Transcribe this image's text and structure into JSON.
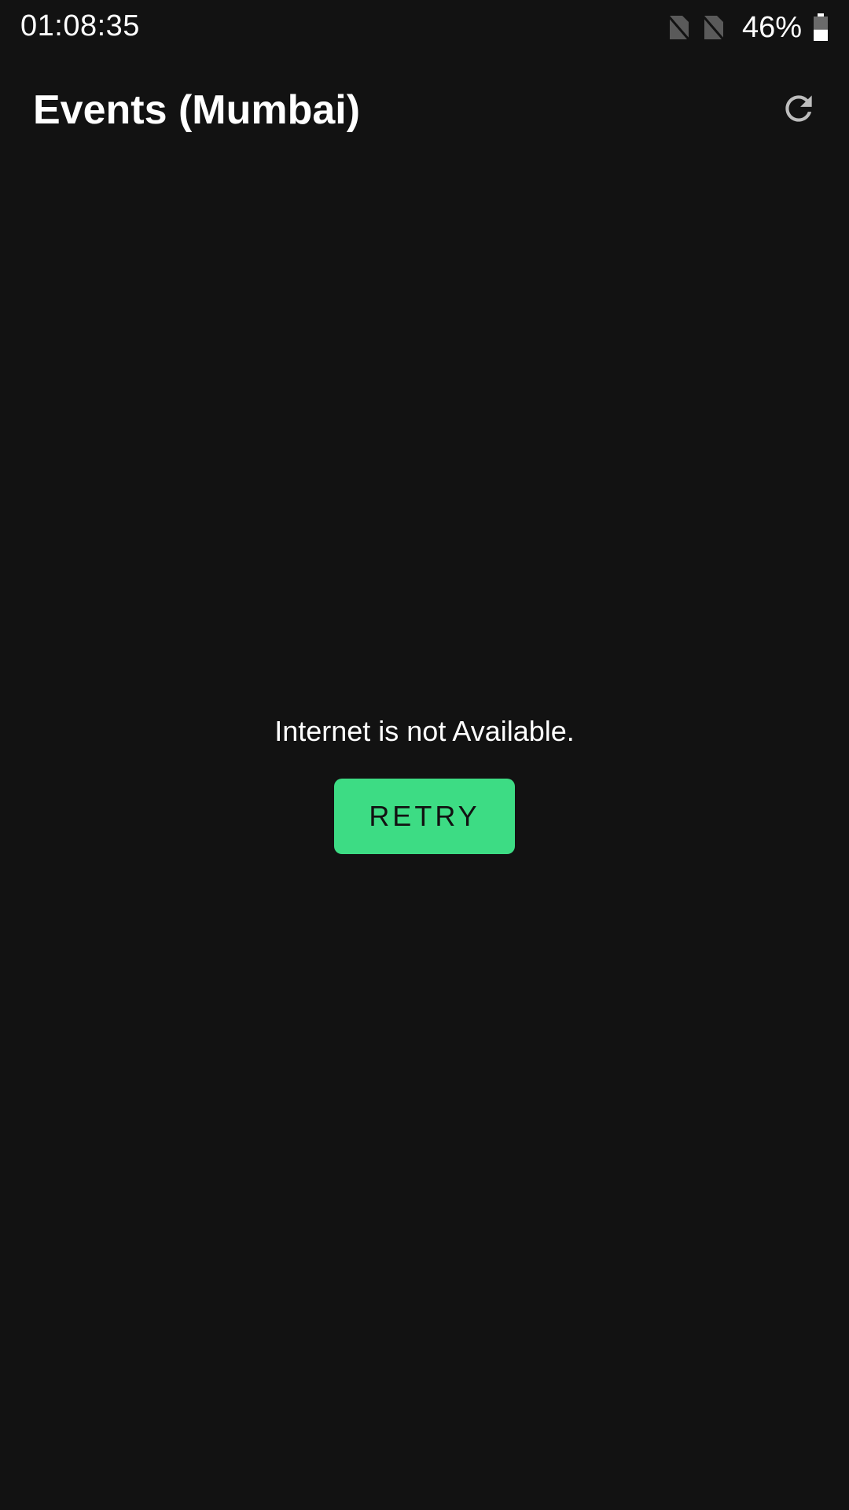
{
  "status_bar": {
    "time": "01:08:35",
    "battery_percent": "46%",
    "battery_level": 0.46,
    "icons": [
      "no-sim-icon",
      "no-sim-icon",
      "battery-icon"
    ]
  },
  "app_bar": {
    "title": "Events (Mumbai)",
    "refresh_icon": "refresh-icon"
  },
  "empty_state": {
    "message": "Internet is not Available.",
    "retry_label": "RETRY"
  },
  "colors": {
    "background": "#121212",
    "accent": "#3ddc84",
    "text": "#ffffff",
    "icon_gray": "#bdbdbd"
  }
}
